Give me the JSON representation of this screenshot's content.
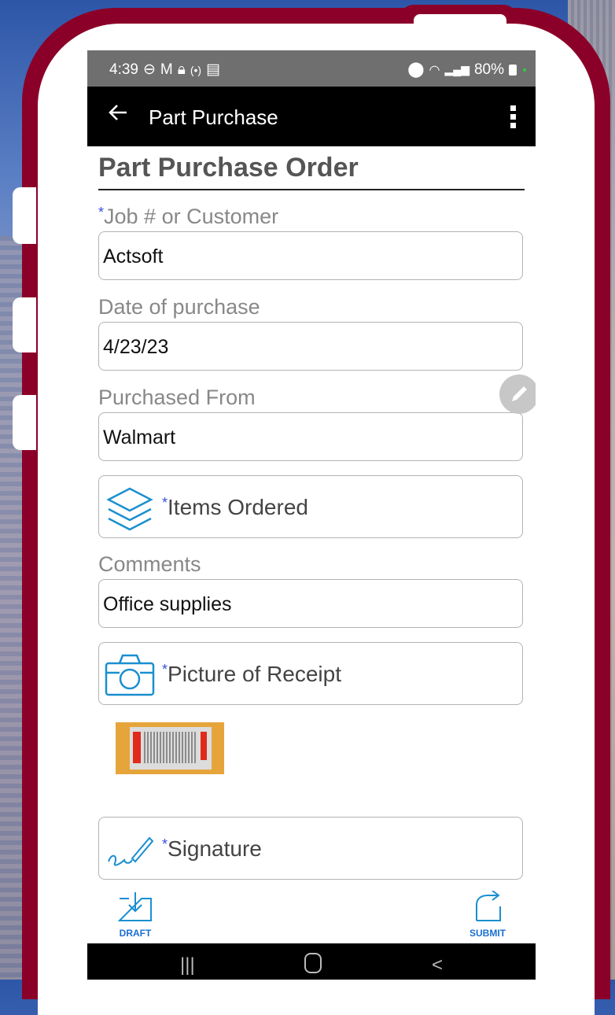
{
  "status_bar": {
    "time": "4:39",
    "left_icons": [
      "do-not-disturb-icon",
      "gmail-icon",
      "lock-icon",
      "hotspot-icon",
      "calendar-icon"
    ],
    "battery": "80%",
    "right_icons": [
      "location-icon",
      "wifi-icon",
      "signal-icon",
      "battery-icon"
    ]
  },
  "app_bar": {
    "title": "Part Purchase"
  },
  "form": {
    "title": "Part Purchase Order",
    "fields": {
      "job": {
        "label": "Job # or Customer",
        "value": "Actsoft",
        "required": true
      },
      "date": {
        "label": "Date of purchase",
        "value": "4/23/23"
      },
      "purchased_from": {
        "label": "Purchased From",
        "value": "Walmart"
      },
      "comments": {
        "label": "Comments",
        "value": "Office supplies"
      }
    },
    "items_ordered": {
      "label": "Items Ordered",
      "required": true
    },
    "picture_of_receipt": {
      "label": "Picture of Receipt",
      "required": true
    },
    "signature": {
      "label": "Signature",
      "required": true
    },
    "required_marker": "*"
  },
  "bottom_actions": {
    "draft": "DRAFT",
    "submit": "SUBMIT"
  },
  "nav_bar": {
    "recents": "|||",
    "home": "O",
    "back": "<"
  },
  "colors": {
    "frame": "#8b0028",
    "accent_icon": "#1a8fd0",
    "required": "#3a4fd8"
  }
}
